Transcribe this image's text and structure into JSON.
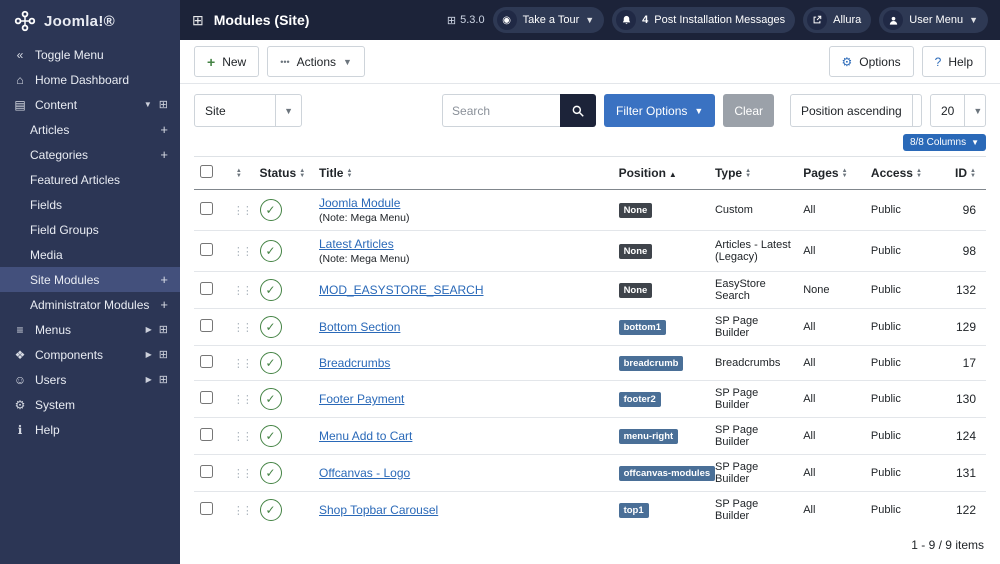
{
  "colors": {
    "sidebar": "#2c3655",
    "header": "#1c2339",
    "accent": "#2a69b8",
    "success": "#448344",
    "badge_dark": "#3f444b",
    "badge_blue": "#4a6f97"
  },
  "icons": {
    "toggle-menu": "«",
    "home": "⌂",
    "content": "▤",
    "menus": "≡",
    "components": "❖",
    "users": "☺",
    "system": "⚙",
    "help": "ℹ",
    "chevron-down": "▼",
    "chevron-right": "▶",
    "plus": "+",
    "grid": "⊞",
    "drag-handle": "⋮⋮",
    "check": "✓",
    "sort-asc": "▲",
    "sort-desc": "▼",
    "gear": "⚙",
    "question": "?",
    "ellipsis": "•••",
    "module": "⊞",
    "tour": "◉"
  },
  "sidebar": {
    "logo": "Joomla!®",
    "items": [
      {
        "label": "Toggle Menu",
        "icon": "toggle-menu"
      },
      {
        "label": "Home Dashboard",
        "icon": "home"
      },
      {
        "label": "Content",
        "icon": "content",
        "expand": "down",
        "grid": true
      },
      {
        "label": "Articles",
        "indent": true,
        "plus": true
      },
      {
        "label": "Categories",
        "indent": true,
        "plus": true
      },
      {
        "label": "Featured Articles",
        "indent": true
      },
      {
        "label": "Fields",
        "indent": true
      },
      {
        "label": "Field Groups",
        "indent": true
      },
      {
        "label": "Media",
        "indent": true
      },
      {
        "label": "Site Modules",
        "indent": true,
        "plus": true,
        "active": true
      },
      {
        "label": "Administrator Modules",
        "indent": true,
        "plus": true
      },
      {
        "label": "Menus",
        "icon": "menus",
        "expand": "right",
        "grid": true
      },
      {
        "label": "Components",
        "icon": "components",
        "expand": "right",
        "grid": true
      },
      {
        "label": "Users",
        "icon": "users",
        "expand": "right",
        "grid": true
      },
      {
        "label": "System",
        "icon": "system"
      },
      {
        "label": "Help",
        "icon": "help"
      }
    ]
  },
  "header": {
    "title": "Modules (Site)",
    "version": "5.3.0",
    "tour_label": "Take a Tour",
    "notif_count": "4",
    "notif_label": "Post Installation Messages",
    "allura_label": "Allura",
    "user_menu_label": "User Menu"
  },
  "toolbar": {
    "new_label": "New",
    "actions_label": "Actions",
    "options_label": "Options",
    "help_label": "Help"
  },
  "filters": {
    "site_value": "Site",
    "search_placeholder": "Search",
    "filter_options_label": "Filter Options",
    "clear_label": "Clear",
    "sort_value": "Position ascending",
    "limit_value": "20",
    "columns_label": "8/8 Columns"
  },
  "table": {
    "headers": {
      "status": "Status",
      "title": "Title",
      "position": "Position",
      "type": "Type",
      "pages": "Pages",
      "access": "Access",
      "id": "ID"
    },
    "rows": [
      {
        "title": "Joomla Module",
        "note": "(Note: Mega Menu)",
        "position": "None",
        "position_style": "dark",
        "type": "Custom",
        "pages": "All",
        "access": "Public",
        "id": "96"
      },
      {
        "title": "Latest Articles",
        "note": "(Note: Mega Menu)",
        "position": "None",
        "position_style": "dark",
        "type": "Articles - Latest (Legacy)",
        "pages": "All",
        "access": "Public",
        "id": "98"
      },
      {
        "title": "MOD_EASYSTORE_SEARCH",
        "note": "",
        "position": "None",
        "position_style": "dark",
        "type": "EasyStore Search",
        "pages": "None",
        "access": "Public",
        "id": "132"
      },
      {
        "title": "Bottom Section",
        "note": "",
        "position": "bottom1",
        "position_style": "blue",
        "type": "SP Page Builder",
        "pages": "All",
        "access": "Public",
        "id": "129"
      },
      {
        "title": "Breadcrumbs",
        "note": "",
        "position": "breadcrumb",
        "position_style": "blue",
        "type": "Breadcrumbs",
        "pages": "All",
        "access": "Public",
        "id": "17"
      },
      {
        "title": "Footer Payment",
        "note": "",
        "position": "footer2",
        "position_style": "blue",
        "type": "SP Page Builder",
        "pages": "All",
        "access": "Public",
        "id": "130"
      },
      {
        "title": "Menu Add to Cart",
        "note": "",
        "position": "menu-right",
        "position_style": "blue",
        "type": "SP Page Builder",
        "pages": "All",
        "access": "Public",
        "id": "124"
      },
      {
        "title": "Offcanvas - Logo",
        "note": "",
        "position": "offcanvas-modules",
        "position_style": "blue",
        "type": "SP Page Builder",
        "pages": "All",
        "access": "Public",
        "id": "131"
      },
      {
        "title": "Shop Topbar Carousel",
        "note": "",
        "position": "top1",
        "position_style": "blue",
        "type": "SP Page Builder",
        "pages": "All",
        "access": "Public",
        "id": "122"
      }
    ]
  },
  "footer": {
    "items_label": "1 - 9 / 9 items"
  }
}
